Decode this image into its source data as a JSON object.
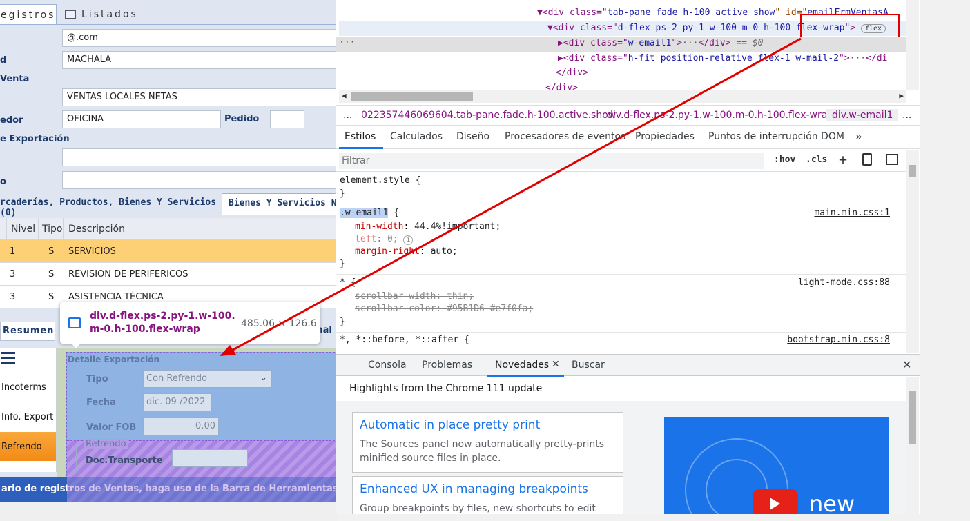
{
  "app": {
    "tabs": {
      "registros": "egistros",
      "listados": "Listados"
    },
    "fields": {
      "email_value": "@.com",
      "ciudad_label": "d",
      "ciudad_value": "MACHALA",
      "venta_label": "Venta",
      "tipo_venta_value": "VENTAS LOCALES NETAS",
      "vendedor_label": "edor",
      "vendedor_value": "OFICINA",
      "pedido_label": "Pedido",
      "exportacion_label": "e Exportación",
      "o_label": "o"
    },
    "subtabs": {
      "mercaderias": "rcaderías, Productos, Bienes Y Servicios (0)",
      "bienes": "Bienes Y Servicios No"
    },
    "grid": {
      "headers": {
        "nivel": "Nivel",
        "tipo": "Tipo",
        "descripcion": "Descripción"
      },
      "rows": [
        {
          "nivel": "1",
          "tipo": "S",
          "desc": "SERVICIOS"
        },
        {
          "nivel": "3",
          "tipo": "S",
          "desc": "REVISION DE PERIFERICOS"
        },
        {
          "nivel": "3",
          "tipo": "S",
          "desc": "ASISTENCIA TÉCNICA"
        }
      ]
    },
    "bottom_tabs": {
      "resumen": "Resumen",
      "adicional": "ional"
    },
    "side_menu": {
      "incoterms": "Incoterms",
      "info_export": "Info. Export",
      "refrendo": "Refrendo"
    },
    "detalle": {
      "title": "Detalle Exportación",
      "tipo_label": "Tipo",
      "tipo_value": "Con Refrendo",
      "fecha_label": "Fecha",
      "fecha_value": "dic. 09 /2022",
      "fob_label": "Valor FOB",
      "fob_value": "0.00",
      "refrendo_legend": "Refrendo",
      "doc_label": "Doc.Transporte"
    },
    "status_bar": "ario de registros de Ventas, haga uso de la Barra de Herramientas para c",
    "tooltip": {
      "selector": "div.d-flex.ps-2.py-1.w-100.m-0.h-100.flex-wrap",
      "size": "485.06 × 126.6"
    }
  },
  "devtools": {
    "elements": {
      "line1": {
        "open": "▼<div class=\"",
        "cls": "tab-pane fade h-100 active show",
        "id_attr": "\" id=\"",
        "id_val": "emailFrmVentasA"
      },
      "line2": {
        "open": "▼<div class=\"",
        "cls": "d-flex ps-2 py-1 w-100 m-0 h-100 flex-wrap",
        "close": "\">",
        "badge": "flex"
      },
      "line3": {
        "open": "▶<div class=\"",
        "cls": "w-email1",
        "close": "\">",
        "dots": "···",
        "end": "</div>",
        "eq": "== $0"
      },
      "line4": {
        "open": "▶<div class=\"",
        "cls": "h-fit position-relative flex-1 w-mail-2",
        "close": "\">",
        "dots": "···",
        "end": "</di"
      },
      "line5": "</div>",
      "line6": "</div>"
    },
    "breadcrumb": {
      "dots": "...",
      "c1": "022357446069604.tab-pane.fade.h-100.active.show",
      "c2": "div.d-flex.ps-2.py-1.w-100.m-0.h-100.flex-wrap",
      "c3": "div.w-email1",
      "more": "..."
    },
    "panel_tabs": [
      "Estilos",
      "Calculados",
      "Diseño",
      "Procesadores de eventos",
      "Propiedades",
      "Puntos de interrupción DOM"
    ],
    "filter_placeholder": "Filtrar",
    "hov": ":hov",
    "cls": ".cls",
    "styles": {
      "element_style": "element.style {",
      "brace_close": "}",
      "rule1_selector": ".w-email1",
      "rule1_open": " {",
      "rule1_source": "main.min.css:1",
      "rule1_props": [
        {
          "name": "min-width",
          "value": "44.4%!important;"
        },
        {
          "name": "left",
          "value": "0;"
        },
        {
          "name": "margin-right",
          "value": "auto;"
        }
      ],
      "rule2_selector": "* {",
      "rule2_source": "light-mode.css:88",
      "rule2_props": [
        {
          "name": "scrollbar-width",
          "value": "thin;"
        },
        {
          "name": "scrollbar-color",
          "value": "#95B1D6 #e7f0fa;"
        }
      ],
      "rule3_selector": "*, *::before, *::after {",
      "rule3_source": "bootstrap.min.css:8"
    },
    "drawer_tabs": {
      "consola": "Consola",
      "problemas": "Problemas",
      "novedades": "Novedades",
      "buscar": "Buscar"
    },
    "highlights_title": "Highlights from the Chrome 111 update",
    "cards": [
      {
        "title": "Automatic in place pretty print",
        "desc": "The Sources panel now automatically pretty-prints minified source files in place."
      },
      {
        "title": "Enhanced UX in managing breakpoints",
        "desc": "Group breakpoints by files, new shortcuts to edit"
      }
    ],
    "video_text": "new"
  },
  "colors": {
    "accent": "#1a73e8",
    "highlight_row": "#fdd076",
    "orange": "#f79b25",
    "overlay": "#8fb4e3",
    "status_bar": "#2f5fbd",
    "arrow": "#e00000"
  }
}
